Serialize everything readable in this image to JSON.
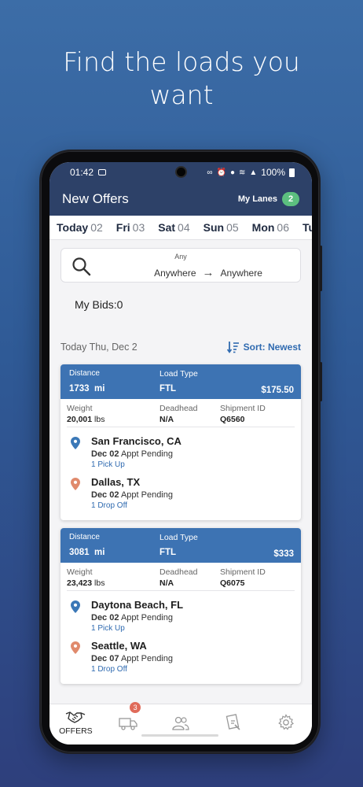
{
  "promo": {
    "headline_line1": "Find the loads you",
    "headline_line2": "want"
  },
  "status_bar": {
    "time": "01:42",
    "battery": "100%"
  },
  "header": {
    "title": "New Offers",
    "my_lanes_label": "My Lanes",
    "my_lanes_count": "2"
  },
  "day_tabs": [
    {
      "day": "Today",
      "date": "02",
      "active": true
    },
    {
      "day": "Fri",
      "date": "03"
    },
    {
      "day": "Sat",
      "date": "04"
    },
    {
      "day": "Sun",
      "date": "05"
    },
    {
      "day": "Mon",
      "date": "06"
    },
    {
      "day": "Tu",
      "date": ""
    }
  ],
  "search": {
    "equipment": "Any",
    "origin": "Anywhere",
    "destination": "Anywhere",
    "arrow": "→"
  },
  "bids": {
    "label": "My Bids:0"
  },
  "list": {
    "date_label": "Today Thu, Dec 2",
    "sort_label": "Sort: Newest"
  },
  "labels": {
    "distance": "Distance",
    "load_type": "Load Type",
    "weight": "Weight",
    "deadhead": "Deadhead",
    "shipment_id": "Shipment ID",
    "mi": "mi",
    "lbs": "lbs",
    "appt_pending": "Appt Pending"
  },
  "loads": [
    {
      "distance": "1733",
      "load_type": "FTL",
      "price": "$175.50",
      "weight": "20,001",
      "deadhead": "N/A",
      "shipment_id": "Q6560",
      "origin": {
        "city": "San Francisco, CA",
        "date": "Dec 02",
        "action": "1 Pick Up"
      },
      "destination": {
        "city": "Dallas, TX",
        "date": "Dec 02",
        "action": "1 Drop Off"
      }
    },
    {
      "distance": "3081",
      "load_type": "FTL",
      "price": "$333",
      "weight": "23,423",
      "deadhead": "N/A",
      "shipment_id": "Q6075",
      "origin": {
        "city": "Daytona Beach, FL",
        "date": "Dec 02",
        "action": "1 Pick Up"
      },
      "destination": {
        "city": "Seattle, WA",
        "date": "Dec 07",
        "action": "1 Drop Off"
      }
    }
  ],
  "bottom_nav": {
    "offers_label": "OFFERS",
    "trucks_badge": "3"
  },
  "colors": {
    "header_bg": "#2d4168",
    "card_header": "#3d73b3",
    "accent_blue": "#2f6ab0",
    "pickup_pin": "#3b78b7",
    "dropoff_pin": "#e08a6c",
    "lanes_badge": "#5cbf7f",
    "alert_badge": "#e06b5a"
  },
  "icons": [
    "search-icon",
    "sort-icon",
    "handshake-icon",
    "truck-icon",
    "users-icon",
    "document-icon",
    "gear-icon",
    "pickup-pin-icon",
    "dropoff-pin-icon"
  ]
}
